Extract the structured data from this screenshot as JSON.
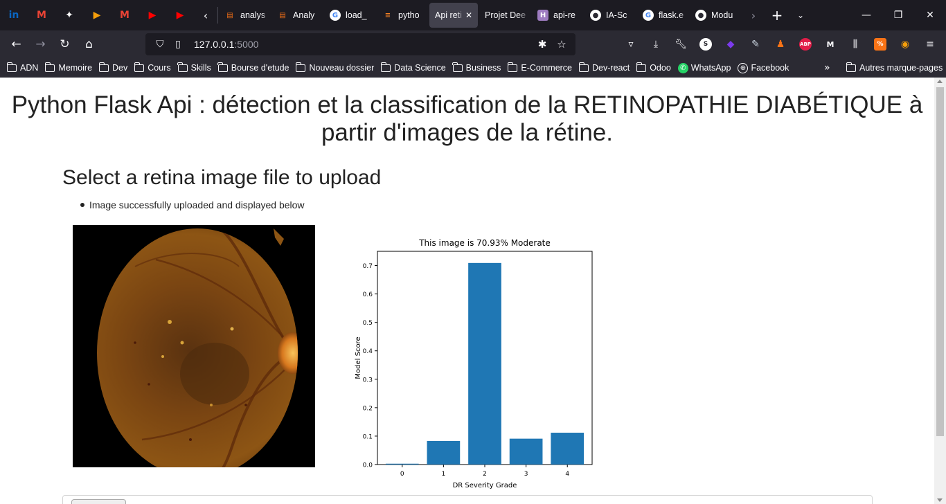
{
  "browser": {
    "pinned_tabs": [
      {
        "icon": "linkedin-icon",
        "glyph": "in",
        "color": "#0a66c2"
      },
      {
        "icon": "gmail-icon",
        "glyph": "M",
        "color": "#ea4335"
      },
      {
        "icon": "game-icon",
        "glyph": "✦",
        "color": "#ffffff"
      },
      {
        "icon": "play-icon",
        "glyph": "▶",
        "color": "#f59e0b"
      },
      {
        "icon": "gmail-icon",
        "glyph": "M",
        "color": "#ea4335"
      },
      {
        "icon": "youtube-icon",
        "glyph": "▶",
        "color": "#ff0000"
      },
      {
        "icon": "youtube-icon",
        "glyph": "▶",
        "color": "#ff0000"
      }
    ],
    "tabs": [
      {
        "title": "analys",
        "icon": "book-icon",
        "fav_glyph": "▤",
        "fav_color": "#f97316",
        "active": false
      },
      {
        "title": "Analy",
        "icon": "book-icon",
        "fav_glyph": "▤",
        "fav_color": "#f97316",
        "active": false
      },
      {
        "title": "load_",
        "icon": "google-icon",
        "fav_glyph": "G",
        "fav_color": "#4285f4",
        "active": false
      },
      {
        "title": "pytho",
        "icon": "stackoverflow-icon",
        "fav_glyph": "≡",
        "fav_color": "#f48024",
        "active": false
      },
      {
        "title": "Api reti",
        "icon": "none",
        "fav_glyph": "",
        "fav_color": "",
        "active": true
      },
      {
        "title": "Projet Dee",
        "icon": "none",
        "fav_glyph": "",
        "fav_color": "",
        "active": false
      },
      {
        "title": "api-re",
        "icon": "heroku-icon",
        "fav_glyph": "H",
        "fav_color": "#9e7cc1",
        "active": false
      },
      {
        "title": "IA-Sc",
        "icon": "github-icon",
        "fav_glyph": "●",
        "fav_color": "#2b2a33",
        "active": false
      },
      {
        "title": "flask.e",
        "icon": "google-icon",
        "fav_glyph": "G",
        "fav_color": "#4285f4",
        "active": false
      },
      {
        "title": "Modu",
        "icon": "github-icon",
        "fav_glyph": "●",
        "fav_color": "#2b2a33",
        "active": false
      }
    ],
    "url": {
      "host": "127.0.0.1",
      "port": ":5000"
    },
    "bookmarks": [
      {
        "label": "ADN",
        "type": "folder"
      },
      {
        "label": "Memoire",
        "type": "folder"
      },
      {
        "label": "Dev",
        "type": "folder"
      },
      {
        "label": "Cours",
        "type": "folder"
      },
      {
        "label": "Skills",
        "type": "folder"
      },
      {
        "label": "Bourse d'etude",
        "type": "folder"
      },
      {
        "label": "Nouveau dossier",
        "type": "folder"
      },
      {
        "label": "Data Science",
        "type": "folder"
      },
      {
        "label": "Business",
        "type": "folder"
      },
      {
        "label": "E-Commerce",
        "type": "folder"
      },
      {
        "label": "Dev-react",
        "type": "folder"
      },
      {
        "label": "Odoo",
        "type": "folder"
      },
      {
        "label": "WhatsApp",
        "type": "whatsapp"
      },
      {
        "label": "Facebook",
        "type": "globe"
      }
    ],
    "other_bookmarks": "Autres marque-pages"
  },
  "page": {
    "title": "Python Flask Api : détection et la classification de la RETINOPATHIE DIABÉTIQUE à partir d'images de la rétine.",
    "heading": "Select a retina image file to upload",
    "flash_message": "Image successfully uploaded and displayed below"
  },
  "chart_data": {
    "type": "bar",
    "title": "This image is 70.93% Moderate",
    "xlabel": "DR Severity Grade",
    "ylabel": "Model Score",
    "categories": [
      "0",
      "1",
      "2",
      "3",
      "4"
    ],
    "values": [
      0.003,
      0.083,
      0.709,
      0.091,
      0.112
    ],
    "ylim": [
      0,
      0.75
    ],
    "yticks": [
      "0.0",
      "0.1",
      "0.2",
      "0.3",
      "0.4",
      "0.5",
      "0.6",
      "0.7"
    ],
    "bar_color": "#1f77b4",
    "grid": false
  }
}
